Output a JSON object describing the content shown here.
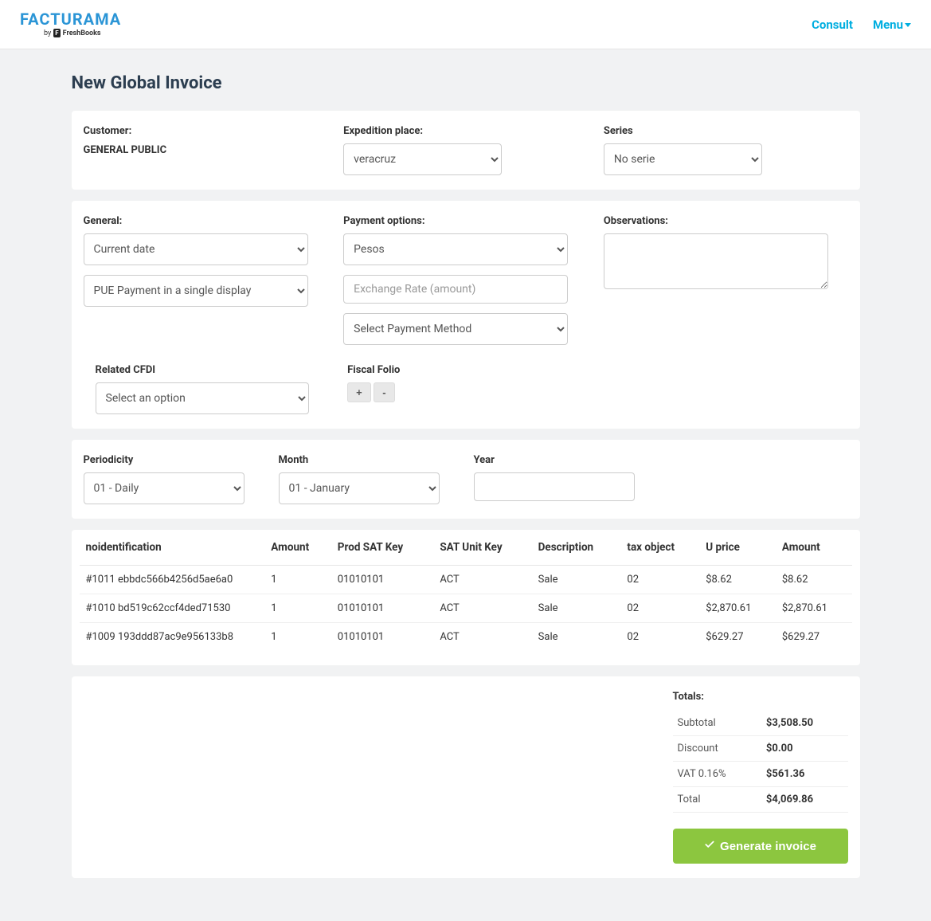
{
  "nav": {
    "brand": "FACTURAMA",
    "by": "by",
    "freshbooks": "FreshBooks",
    "consult": "Consult",
    "menu": "Menu"
  },
  "page": {
    "title": "New Global Invoice"
  },
  "customer": {
    "label": "Customer:",
    "value": "GENERAL PUBLIC"
  },
  "expedition": {
    "label": "Expedition place:",
    "selected": "veracruz"
  },
  "series": {
    "label": "Series",
    "selected": "No serie"
  },
  "general": {
    "label": "General:",
    "date": "Current date",
    "payment_form": "PUE Payment in a single display"
  },
  "payment_options": {
    "label": "Payment options:",
    "currency": "Pesos",
    "exchange_placeholder": "Exchange Rate (amount)",
    "method": "Select Payment Method"
  },
  "observations": {
    "label": "Observations:",
    "value": ""
  },
  "related_cfdi": {
    "label": "Related CFDI",
    "selected": "Select an option"
  },
  "fiscal_folio": {
    "label": "Fiscal Folio",
    "add": "+",
    "remove": "-"
  },
  "periodicity": {
    "label": "Periodicity",
    "selected": "01 - Daily"
  },
  "month": {
    "label": "Month",
    "selected": "01 - January"
  },
  "year": {
    "label": "Year",
    "value": ""
  },
  "table": {
    "headers": {
      "noid": "noidentification",
      "amount_qty": "Amount",
      "prodsat": "Prod SAT Key",
      "satunit": "SAT Unit Key",
      "desc": "Description",
      "taxobj": "tax object",
      "uprice": "U price",
      "amount": "Amount"
    },
    "rows": [
      {
        "noid": "#1011 ebbdc566b4256d5ae6a0",
        "qty": "1",
        "prodsat": "01010101",
        "satunit": "ACT",
        "desc": "Sale",
        "taxobj": "02",
        "uprice": "$8.62",
        "amount": "$8.62"
      },
      {
        "noid": "#1010 bd519c62ccf4ded71530",
        "qty": "1",
        "prodsat": "01010101",
        "satunit": "ACT",
        "desc": "Sale",
        "taxobj": "02",
        "uprice": "$2,870.61",
        "amount": "$2,870.61"
      },
      {
        "noid": "#1009 193ddd87ac9e956133b8",
        "qty": "1",
        "prodsat": "01010101",
        "satunit": "ACT",
        "desc": "Sale",
        "taxobj": "02",
        "uprice": "$629.27",
        "amount": "$629.27"
      }
    ]
  },
  "totals": {
    "title": "Totals:",
    "subtotal_label": "Subtotal",
    "subtotal": "$3,508.50",
    "discount_label": "Discount",
    "discount": "$0.00",
    "vat_label": "VAT 0.16%",
    "vat": "$561.36",
    "total_label": "Total",
    "total": "$4,069.86"
  },
  "generate_btn": "Generate invoice"
}
